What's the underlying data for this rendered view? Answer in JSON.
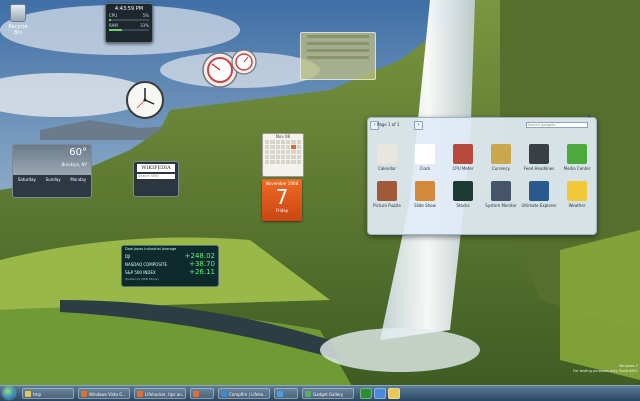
{
  "desktop": {
    "recycle_bin_label": "Recycle Bin"
  },
  "cpu_gadget": {
    "time": "4:43:59 PM",
    "cpu_label": "CPU",
    "cpu_value": "5%",
    "ram_label": "RAM",
    "ram_value": "33%",
    "cpu_level": 0.05,
    "ram_level": 0.33
  },
  "weather": {
    "temp": "60°",
    "location": "Brooklyn, NY",
    "days": [
      "Saturday",
      "Sunday",
      "Monday"
    ]
  },
  "wiki": {
    "logo_text": "WIKIPEDIA",
    "search_placeholder": "Search Wiki"
  },
  "calendar": {
    "month_title": "Nov 08",
    "day_header": "November 2008",
    "day_number": "7",
    "weekday": "Friday"
  },
  "stocks": {
    "title": "Dow Jones Industrial Average",
    "rows": [
      {
        "name": "DJI",
        "value": "+248.02"
      },
      {
        "name": "NASDAQ COMPOSITE",
        "value": "+38.70"
      },
      {
        "name": "S&P 500 INDEX",
        "value": "+26.11"
      }
    ],
    "footer": "Quotes by MSN Money"
  },
  "gallery": {
    "pager": "Page 1 of 1",
    "search_placeholder": "Search gadgets",
    "items": [
      {
        "label": "Calendar",
        "icon": "calendar-icon",
        "color": "#e9e6e0"
      },
      {
        "label": "Clock",
        "icon": "clock-icon",
        "color": "#ffffff"
      },
      {
        "label": "CPU Meter",
        "icon": "cpu-meter-icon",
        "color": "#b74a3a"
      },
      {
        "label": "Currency",
        "icon": "currency-icon",
        "color": "#c8a84a"
      },
      {
        "label": "Feed Headlines",
        "icon": "feed-icon",
        "color": "#3a3f46"
      },
      {
        "label": "Media Center",
        "icon": "media-center-icon",
        "color": "#4caa3c"
      },
      {
        "label": "Picture Puzzle",
        "icon": "puzzle-icon",
        "color": "#a05a3a"
      },
      {
        "label": "Slide Show",
        "icon": "slideshow-icon",
        "color": "#d28a3a"
      },
      {
        "label": "Stocks",
        "icon": "stocks-icon",
        "color": "#1e3a34"
      },
      {
        "label": "System Monitor",
        "icon": "system-monitor-icon",
        "color": "#44546a"
      },
      {
        "label": "Ultimate Explorer",
        "icon": "ultimate-explorer-icon",
        "color": "#2a5a8c"
      },
      {
        "label": "Weather",
        "icon": "weather-icon",
        "color": "#f3c83a"
      }
    ]
  },
  "taskbar": {
    "items": [
      {
        "label": "tmp",
        "icon_color": "#e8c75a"
      },
      {
        "label": "Windows Vista G...",
        "icon_color": "#e0702a"
      },
      {
        "label": "Lifehacker, tips an...",
        "icon_color": "#e0702a"
      },
      {
        "label": "",
        "icon_color": "#e0702a"
      },
      {
        "label": "Compfire | Lifeha...",
        "icon_color": "#3a8ad8"
      },
      {
        "label": "",
        "icon_color": "#4aa0e0"
      },
      {
        "label": "Gadget Gallery",
        "icon_color": "#5ab05a"
      }
    ],
    "quick_icons": [
      "#2e8b3a",
      "#4a8ad8",
      "#e8c75a"
    ]
  },
  "watermark": {
    "line1": "Windows 7",
    "line2": "For testing purposes only. Build 6801"
  }
}
